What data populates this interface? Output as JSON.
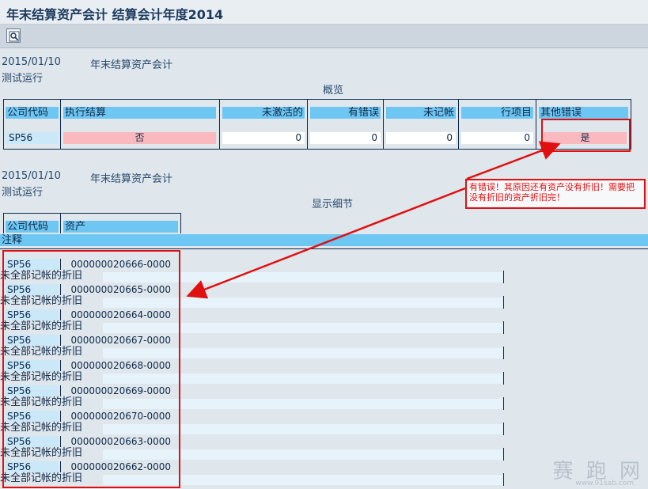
{
  "window": {
    "title": "年末结算资产会计 结算会计年度2014"
  },
  "toolbar": {
    "search_button": "search-icon"
  },
  "overview": {
    "date": "2015/01/10",
    "report_name": "年末结算资产会计",
    "mode": "测试运行",
    "section_title": "概览",
    "headers": [
      "公司代码",
      "执行结算",
      "未激活的",
      "有错误",
      "未记帐",
      "行项目",
      "其他错误"
    ],
    "row": {
      "company": "SP56",
      "executed": "否",
      "inactive": "0",
      "errors": "0",
      "unposted": "0",
      "line_items": "0",
      "other_errors": "是"
    }
  },
  "details": {
    "date": "2015/01/10",
    "report_name": "年末结算资产会计",
    "mode": "测试运行",
    "section_title": "显示细节",
    "headers": [
      "公司代码",
      "资产"
    ],
    "note_header": "注释",
    "rows": [
      {
        "company": "SP56",
        "asset": "000000020666-0000",
        "note": "未全部记帐的折旧"
      },
      {
        "company": "SP56",
        "asset": "000000020665-0000",
        "note": "未全部记帐的折旧"
      },
      {
        "company": "SP56",
        "asset": "000000020664-0000",
        "note": "未全部记帐的折旧"
      },
      {
        "company": "SP56",
        "asset": "000000020667-0000",
        "note": "未全部记帐的折旧"
      },
      {
        "company": "SP56",
        "asset": "000000020668-0000",
        "note": "未全部记帐的折旧"
      },
      {
        "company": "SP56",
        "asset": "000000020669-0000",
        "note": "未全部记帐的折旧"
      },
      {
        "company": "SP56",
        "asset": "000000020670-0000",
        "note": "未全部记帐的折旧"
      },
      {
        "company": "SP56",
        "asset": "000000020663-0000",
        "note": "未全部记帐的折旧"
      },
      {
        "company": "SP56",
        "asset": "000000020662-0000",
        "note": "未全部记帐的折旧"
      }
    ]
  },
  "annotation": {
    "text": "有错误！其原因还有资产没有折旧！需要把没有折旧的资产折旧完！",
    "color": "#e01010"
  },
  "watermark": {
    "text": "赛 跑 网",
    "url": "www.91sab.com"
  },
  "colors": {
    "header_bg": "#6ec6f2",
    "error_cell": "#f9b9bf",
    "background": "#dfe6ec"
  }
}
